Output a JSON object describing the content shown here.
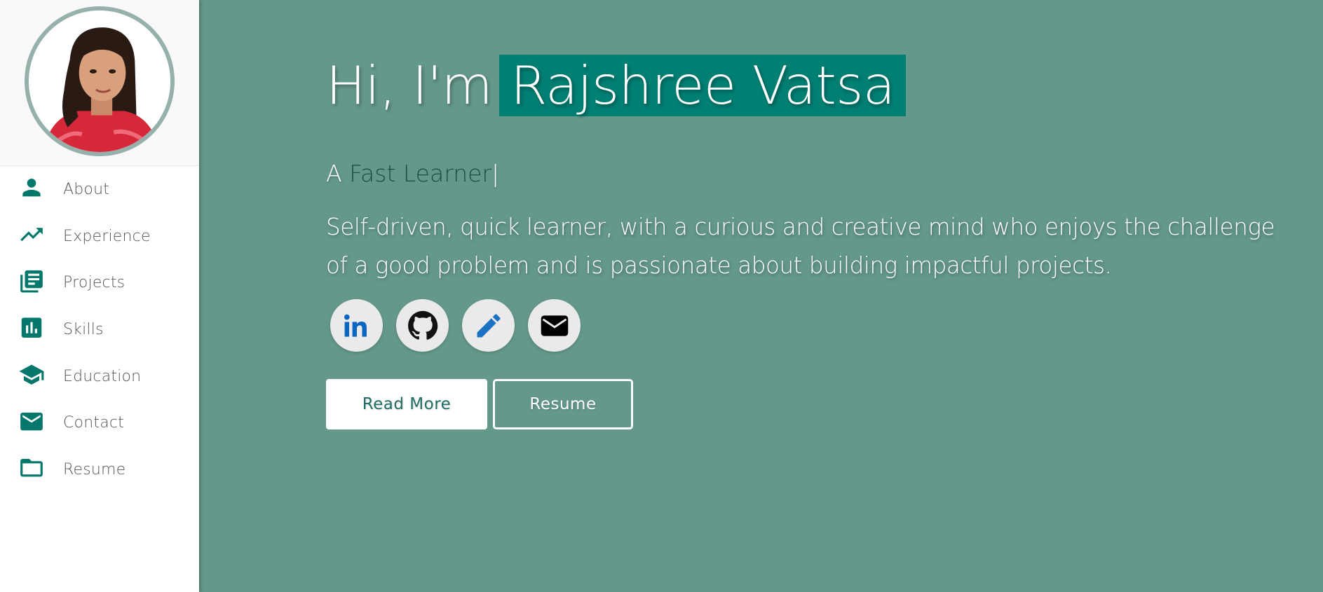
{
  "colors": {
    "main_background": "#64988b",
    "accent": "#05776b",
    "name_highlight": "#007f73",
    "typed_text": "#1f4e47",
    "avatar_ring": "#96b1ac"
  },
  "sidebar": {
    "avatar_icon": "profile-photo",
    "items": [
      {
        "label": "About",
        "icon": "person-icon"
      },
      {
        "label": "Experience",
        "icon": "trending-up-icon"
      },
      {
        "label": "Projects",
        "icon": "library-books-icon"
      },
      {
        "label": "Skills",
        "icon": "bar-chart-icon"
      },
      {
        "label": "Education",
        "icon": "graduation-cap-icon"
      },
      {
        "label": "Contact",
        "icon": "mail-icon"
      },
      {
        "label": "Resume",
        "icon": "folder-icon"
      }
    ]
  },
  "hero": {
    "greeting": "Hi, I'm",
    "name": "Rajshree Vatsa",
    "tagline_prefix": "A",
    "tagline_typed": "Fast Learner",
    "tagline_cursor": "|",
    "bio": "Self-driven, quick learner, with a curious and creative mind who enjoys the challenge of a good problem and is passionate about building impactful projects.",
    "socials": [
      {
        "icon": "linkedin-icon"
      },
      {
        "icon": "github-icon"
      },
      {
        "icon": "pencil-icon"
      },
      {
        "icon": "envelope-icon"
      }
    ],
    "buttons": {
      "read_more": "Read More",
      "resume": "Resume"
    }
  }
}
